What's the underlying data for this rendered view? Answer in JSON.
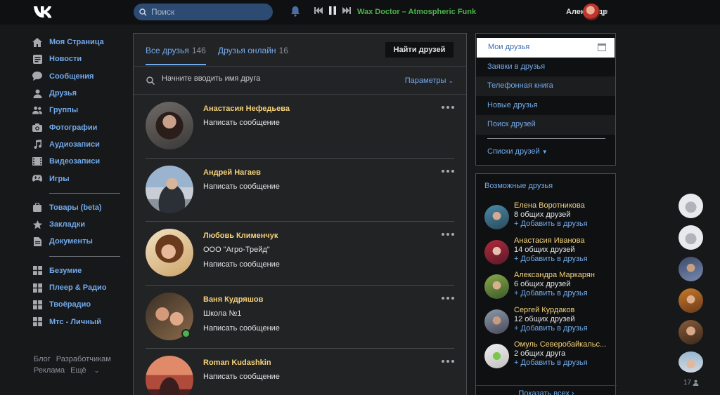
{
  "header": {
    "search_placeholder": "Поиск",
    "track": "Wax Doctor – Atmospheric Funk",
    "user_name": "Александр"
  },
  "leftnav": {
    "group1": [
      {
        "label": "Моя Страница",
        "icon": "home-icon"
      },
      {
        "label": "Новости",
        "icon": "news-icon"
      },
      {
        "label": "Сообщения",
        "icon": "messages-icon"
      },
      {
        "label": "Друзья",
        "icon": "friend-icon"
      },
      {
        "label": "Группы",
        "icon": "groups-icon"
      },
      {
        "label": "Фотографии",
        "icon": "camera-icon"
      },
      {
        "label": "Аудиозаписи",
        "icon": "music-icon"
      },
      {
        "label": "Видеозаписи",
        "icon": "video-icon"
      },
      {
        "label": "Игры",
        "icon": "gamepad-icon"
      }
    ],
    "group2": [
      {
        "label": "Товары (beta)",
        "icon": "bag-icon"
      },
      {
        "label": "Закладки",
        "icon": "star-icon"
      },
      {
        "label": "Документы",
        "icon": "document-icon"
      }
    ],
    "group3": [
      {
        "label": "Безумие",
        "icon": "app-icon"
      },
      {
        "label": "Плеер & Радио",
        "icon": "app-icon"
      },
      {
        "label": "Твоёрадио",
        "icon": "app-icon"
      },
      {
        "label": "Мтс - Личный",
        "icon": "app-icon"
      }
    ],
    "footer": {
      "blog": "Блог",
      "dev": "Разработчикам",
      "ads": "Реклама",
      "more": "Ещё"
    }
  },
  "main": {
    "tab_all": "Все друзья",
    "tab_all_count": "146",
    "tab_online": "Друзья онлайн",
    "tab_online_count": "16",
    "find_button": "Найти друзей",
    "filter_placeholder": "Начните вводить имя друга",
    "params": "Параметры",
    "friends": [
      {
        "name": "Анастасия Нефедьева",
        "line1": "Написать сообщение",
        "line2": ""
      },
      {
        "name": "Андрей Нагаев",
        "line1": "Написать сообщение",
        "line2": ""
      },
      {
        "name": "Любовь Клименчук",
        "line1": "ООО \"Агро-Трейд\"",
        "line2": "Написать сообщение"
      },
      {
        "name": "Ваня Кудряшов",
        "line1": "Школа №1",
        "line2": "Написать сообщение"
      },
      {
        "name": "Roman Kudashkin",
        "line1": "Написать сообщение",
        "line2": ""
      }
    ]
  },
  "rmenu": {
    "items": [
      "Мои друзья",
      "Заявки в друзья",
      "Телефонная книга",
      "Новые друзья",
      "Поиск друзей"
    ],
    "lists": "Списки друзей"
  },
  "possible": {
    "title": "Возможные друзья",
    "add_label": "Добавить в друзья",
    "people": [
      {
        "name": "Елена Воротникова",
        "common": "8 общих друзей"
      },
      {
        "name": "Анастасия Иванова",
        "common": "14 общих друзей"
      },
      {
        "name": "Александра Маркарян",
        "common": "6 общих друзей"
      },
      {
        "name": "Сергей Курдаков",
        "common": "12 общих друзей"
      },
      {
        "name": "Омуль Северобайкальс...",
        "common": "2 общих друга"
      }
    ],
    "show_all": "Показать всех"
  },
  "chats": {
    "count": "17"
  }
}
